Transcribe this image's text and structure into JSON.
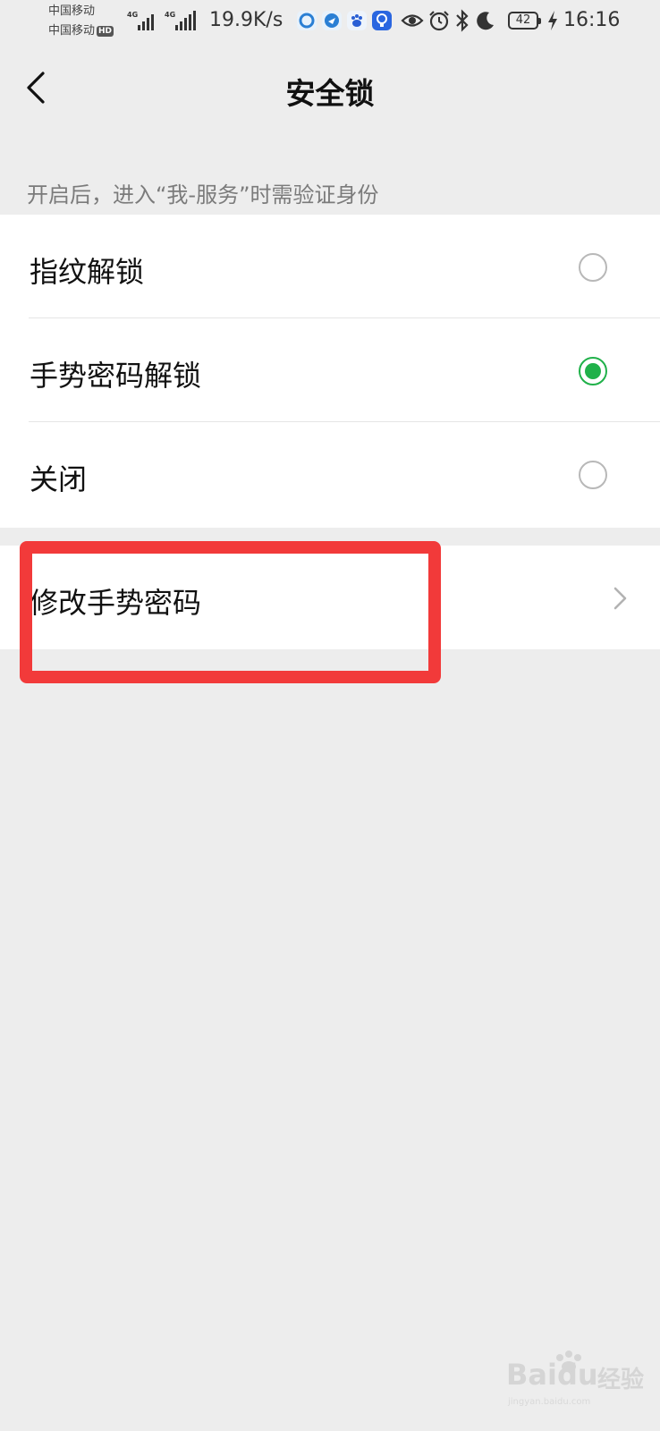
{
  "status_bar": {
    "carrier_1": "中国移动",
    "carrier_2": "中国移动",
    "hd_badge": "HD",
    "network_1": "4G",
    "network_2": "4G",
    "net_speed": "19.9K/s",
    "app_icons": [
      "browser-app-icon",
      "messenger-app-icon",
      "baidu-app-icon",
      "lightbulb-app-icon"
    ],
    "system_icons": [
      "eye-icon",
      "alarm-icon",
      "bluetooth-icon",
      "moon-icon"
    ],
    "battery_level": "42",
    "charging_icon": "bolt-icon",
    "time": "16:16"
  },
  "navbar": {
    "back_icon": "chevron-left-icon",
    "title": "安全锁"
  },
  "hint": "开启后，进入“我-服务”时需验证身份",
  "lock_options": [
    {
      "label": "指纹解锁",
      "selected": false
    },
    {
      "label": "手势密码解锁",
      "selected": true
    },
    {
      "label": "关闭",
      "selected": false
    }
  ],
  "change_pattern": {
    "label": "修改手势密码",
    "icon": "chevron-right-icon"
  },
  "colors": {
    "accent_green": "#20b14a",
    "highlight_red": "#f23a3a",
    "page_bg": "#ededed"
  },
  "watermark": {
    "logo": "Baidu",
    "text": "经验",
    "domain": "jingyan.baidu.com"
  }
}
